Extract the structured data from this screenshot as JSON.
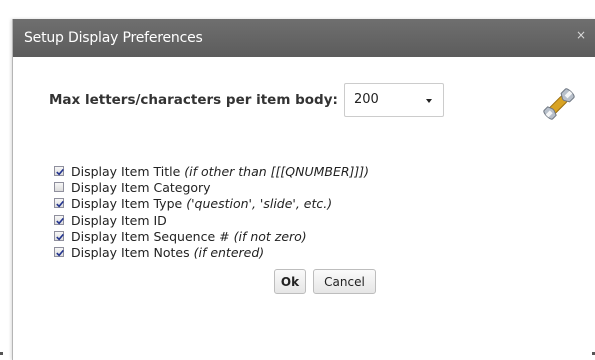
{
  "dialog": {
    "title": "Setup Display Preferences",
    "close_glyph": "×",
    "max_label": "Max letters/characters per item body:",
    "max_select": {
      "selected": "200"
    },
    "options": [
      {
        "label": "Display Item Title",
        "hint": "(if other than [[[QNUMBER]]])",
        "checked": true
      },
      {
        "label": "Display Item Category",
        "hint": "",
        "checked": false
      },
      {
        "label": "Display Item Type",
        "hint": "('question', 'slide', etc.)",
        "checked": true
      },
      {
        "label": "Display Item ID",
        "hint": "",
        "checked": true
      },
      {
        "label": "Display Item Sequence #",
        "hint": "(if not zero)",
        "checked": true
      },
      {
        "label": "Display Item Notes",
        "hint": "(if entered)",
        "checked": true
      }
    ],
    "ok_label": "Ok",
    "cancel_label": "Cancel"
  },
  "icons": {
    "close": "close-icon",
    "dropdown": "chevron-down-icon",
    "settings": "wrench-icon",
    "checkbox": "checkbox-icon"
  },
  "colors": {
    "titlebar": "#666666",
    "title_text": "#ffffff",
    "checkbox_check": "#23348f",
    "wrench_gold": "#d8a323",
    "wrench_steel": "#a8b0bb"
  }
}
